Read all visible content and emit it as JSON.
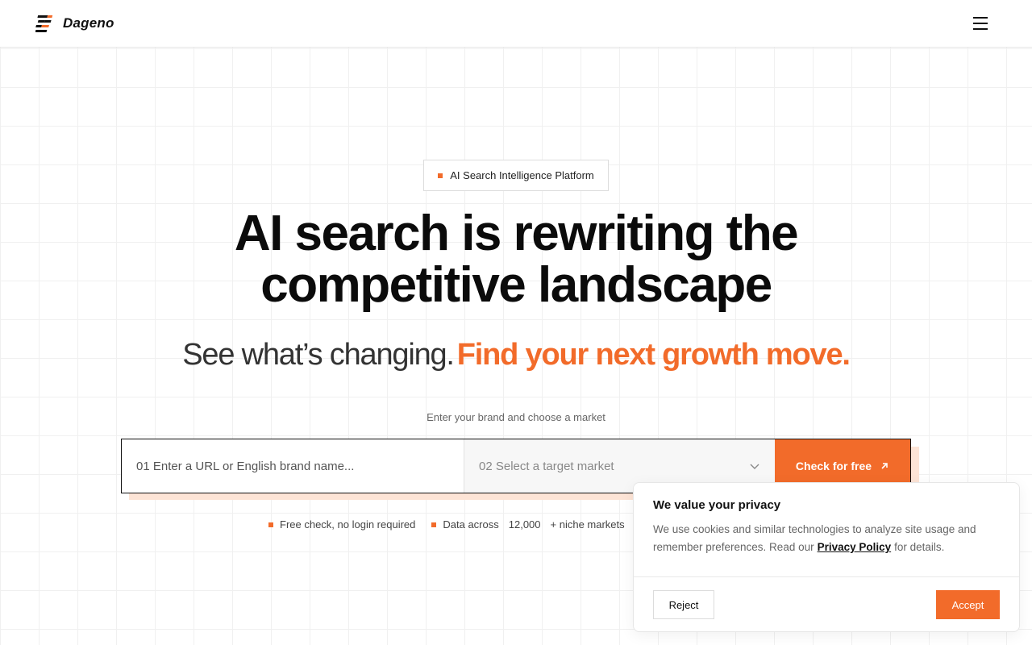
{
  "header": {
    "brand": "Dageno",
    "logo_icon": "dageno-logo-icon",
    "menu_icon": "hamburger-menu-icon"
  },
  "hero": {
    "badge": "AI Search Intelligence Platform",
    "headline_line1": "AI search is rewriting the",
    "headline_line2": "competitive landscape",
    "sub_dark": "See what’s changing.",
    "sub_accent": "Find your next growth move.",
    "hint": "Enter your brand and choose a market"
  },
  "form": {
    "url_placeholder": "01 Enter a URL or English brand name...",
    "market_placeholder": "02 Select a target market",
    "cta_label": "Check for free",
    "chevron_icon": "chevron-down-icon",
    "cta_icon": "arrow-up-right-icon"
  },
  "features": {
    "free_check": "Free check, no login required",
    "data_prefix": "Data across",
    "data_count": "12,000",
    "data_suffix": "+ niche markets"
  },
  "cookie": {
    "title": "We value your privacy",
    "body_before": "We use cookies and similar technologies to analyze site usage and remember preferences. Read our",
    "link": "Privacy Policy",
    "body_after": "for details.",
    "reject": "Reject",
    "accept": "Accept"
  },
  "colors": {
    "accent": "#f26b2a",
    "accent_soft": "#fde4d6",
    "text": "#111111"
  }
}
